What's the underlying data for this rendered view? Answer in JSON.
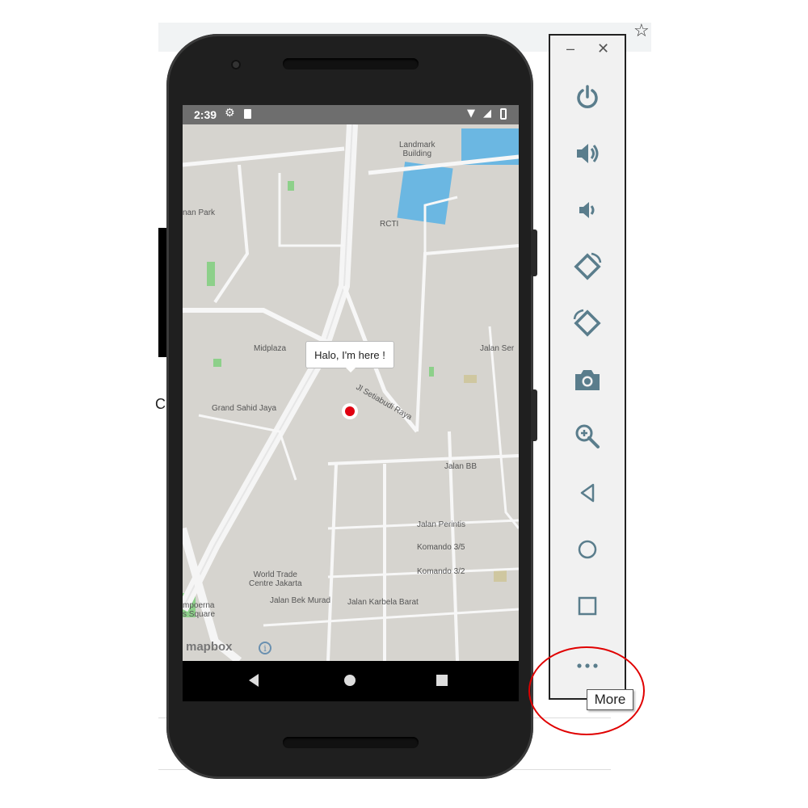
{
  "status_bar": {
    "time": "2:39"
  },
  "map": {
    "popup_text": "Halo, I'm here !",
    "attribution": "mapbox",
    "info_symbol": "i",
    "labels": [
      "Landmark\nBuilding",
      "RCTI",
      "Midplaza",
      "Jalan Ser",
      "Grand Sahid Jaya",
      "Jalan BB",
      "Jalan Perintis",
      "Komando 3/5",
      "Komando 3/2",
      "World Trade\nCentre Jakarta",
      "Jalan Bek Murad",
      "Jalan Karbela Barat",
      "mpoerna\ns Square",
      "nan Park",
      "Jl Setiabudi Raya"
    ]
  },
  "toolbar": {
    "minimize": "–",
    "close": "✕",
    "buttons": [
      {
        "name": "power-icon"
      },
      {
        "name": "volume-up-icon"
      },
      {
        "name": "volume-down-icon"
      },
      {
        "name": "rotate-left-icon"
      },
      {
        "name": "rotate-right-icon"
      },
      {
        "name": "camera-icon"
      },
      {
        "name": "zoom-icon"
      },
      {
        "name": "back-icon"
      },
      {
        "name": "home-icon"
      },
      {
        "name": "overview-icon"
      },
      {
        "name": "more-icon"
      }
    ],
    "tooltip": "More"
  },
  "browser": {
    "star": "☆",
    "partial_text": "C"
  },
  "colors": {
    "accent_icon": "#5a7d8c",
    "highlight_circle": "#e00000",
    "marker": "#e00010"
  }
}
